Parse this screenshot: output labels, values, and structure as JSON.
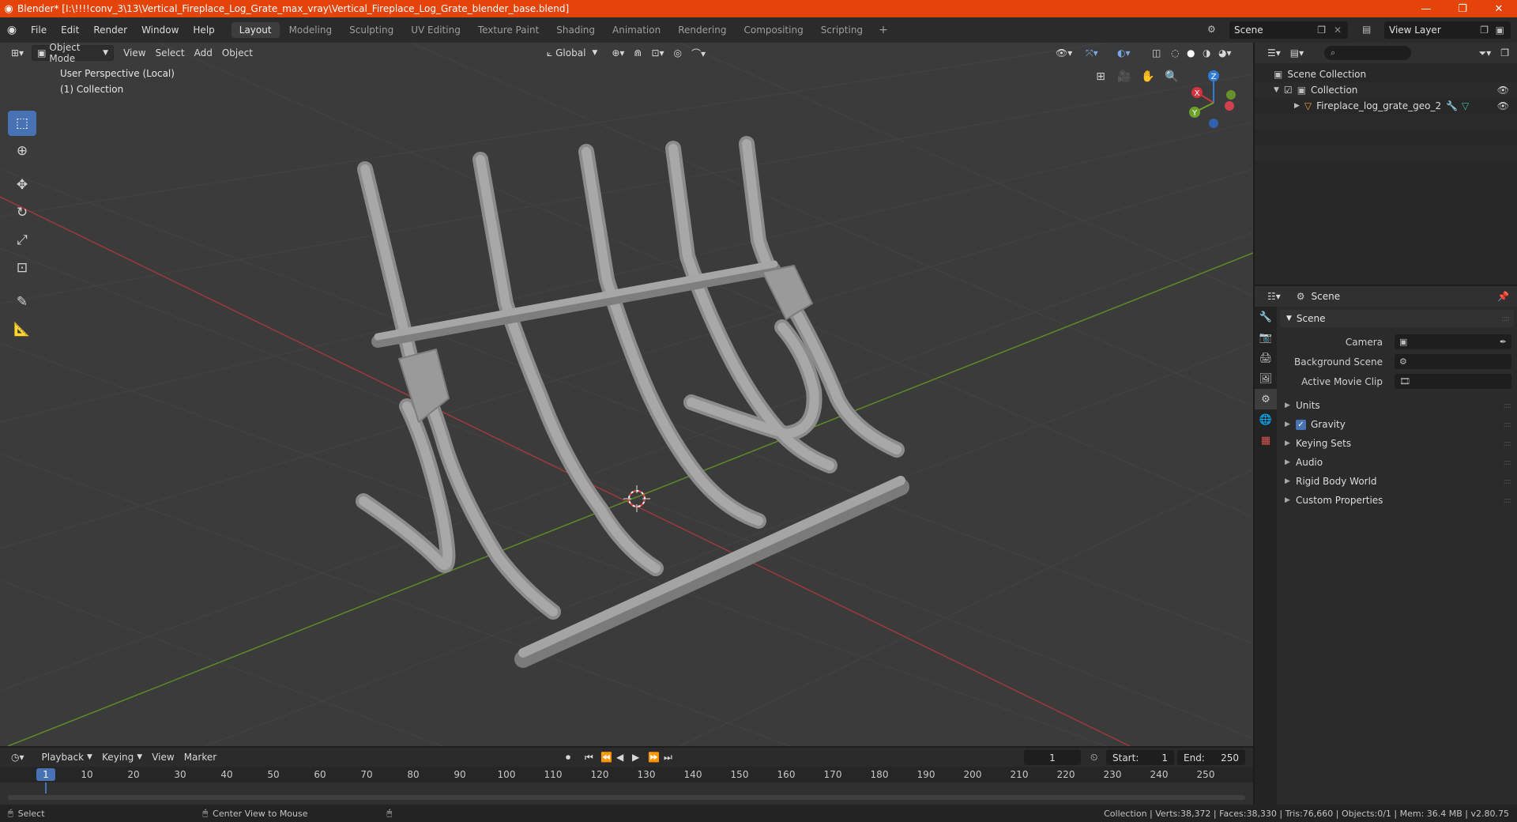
{
  "window": {
    "title": "Blender* [I:\\!!!!conv_3\\13\\Vertical_Fireplace_Log_Grate_max_vray\\Vertical_Fireplace_Log_Grate_blender_base.blend]",
    "minimize": "—",
    "maximize": "❐",
    "close": "✕"
  },
  "menu": [
    "File",
    "Edit",
    "Render",
    "Window",
    "Help"
  ],
  "workspaces": [
    "Layout",
    "Modeling",
    "Sculpting",
    "UV Editing",
    "Texture Paint",
    "Shading",
    "Animation",
    "Rendering",
    "Compositing",
    "Scripting"
  ],
  "active_workspace": "Layout",
  "scene_selector": "Scene",
  "view_layer_selector": "View Layer",
  "viewport": {
    "mode": "Object Mode",
    "menus": [
      "View",
      "Select",
      "Add",
      "Object"
    ],
    "transform_orientation": "Global",
    "perspective_label": "User Perspective (Local)",
    "collection_label": "(1) Collection",
    "gizmo": {
      "x": "X",
      "y": "Y",
      "z": "Z"
    }
  },
  "outliner": {
    "root": "Scene Collection",
    "collection": "Collection",
    "object": "Fireplace_log_grate_geo_2"
  },
  "properties": {
    "context": "Scene",
    "panel": "Scene",
    "rows": [
      {
        "label": "Camera",
        "value": ""
      },
      {
        "label": "Background Scene",
        "value": ""
      },
      {
        "label": "Active Movie Clip",
        "value": ""
      }
    ],
    "subpanels": [
      "Units",
      "Gravity",
      "Keying Sets",
      "Audio",
      "Rigid Body World",
      "Custom Properties"
    ],
    "gravity_checked": true
  },
  "timeline": {
    "menus": [
      "Playback",
      "Keying",
      "View",
      "Marker"
    ],
    "current_frame": "1",
    "start_label": "Start:",
    "start": "1",
    "end_label": "End:",
    "end": "250",
    "ticks": [
      "10",
      "20",
      "30",
      "40",
      "50",
      "60",
      "70",
      "80",
      "90",
      "100",
      "110",
      "120",
      "130",
      "140",
      "150",
      "160",
      "170",
      "180",
      "190",
      "200",
      "210",
      "220",
      "230",
      "240",
      "250"
    ]
  },
  "statusbar": {
    "select": "Select",
    "center_view": "Center View to Mouse",
    "stats": "Collection | Verts:38,372 | Faces:38,330 | Tris:76,660 | Objects:0/1 | Mem: 36.4 MB | v2.80.75"
  },
  "colors": {
    "accent": "#4772b3",
    "titlebar": "#e4430a",
    "x_axis": "#d0343f",
    "y_axis": "#6ea12a",
    "z_axis": "#2e7bd8"
  }
}
